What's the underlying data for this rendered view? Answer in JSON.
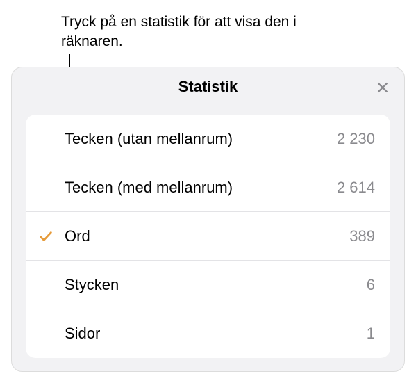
{
  "callout": {
    "text": "Tryck på en statistik för att visa den i räknaren."
  },
  "panel": {
    "title": "Statistik"
  },
  "rows": [
    {
      "label": "Tecken (utan mellanrum)",
      "value": "2 230",
      "selected": false
    },
    {
      "label": "Tecken (med mellanrum)",
      "value": "2 614",
      "selected": false
    },
    {
      "label": "Ord",
      "value": "389",
      "selected": true
    },
    {
      "label": "Stycken",
      "value": "6",
      "selected": false
    },
    {
      "label": "Sidor",
      "value": "1",
      "selected": false
    }
  ]
}
